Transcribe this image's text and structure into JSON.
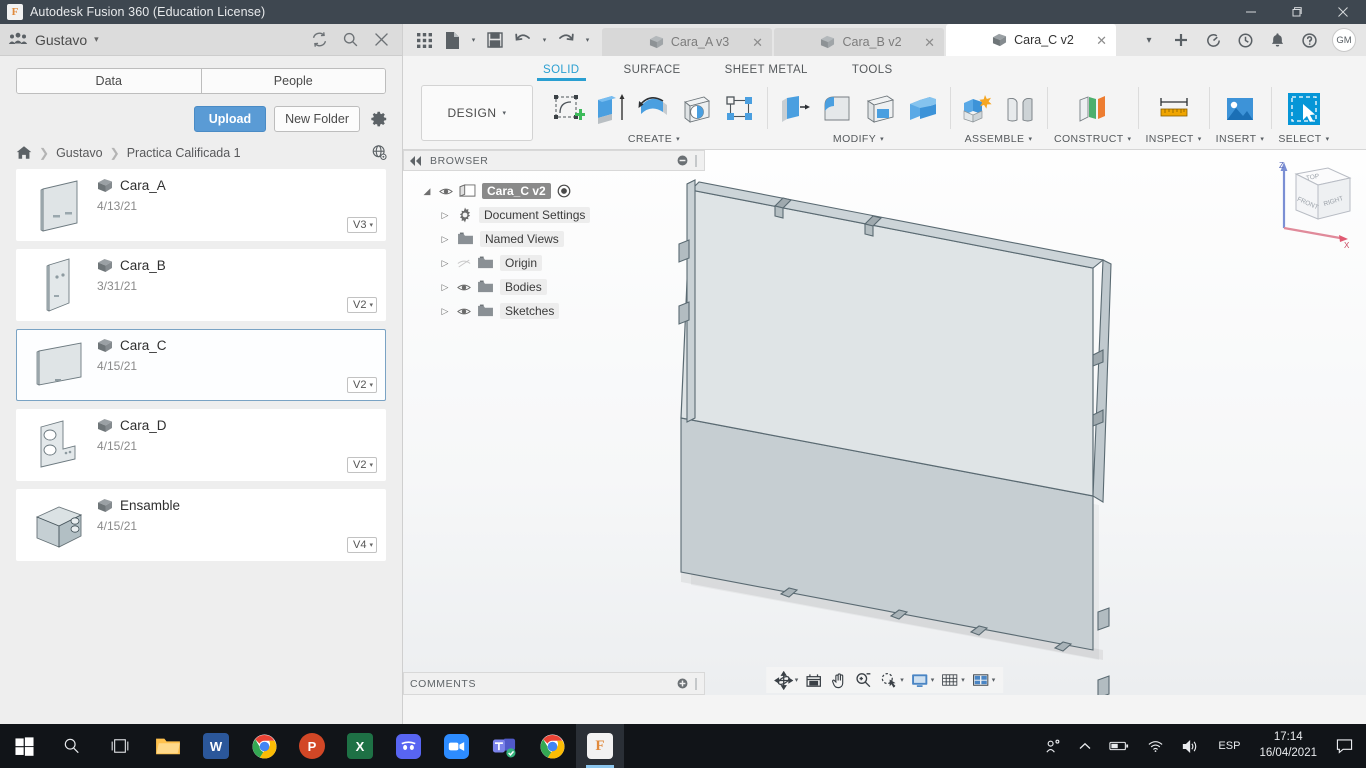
{
  "window": {
    "title": "Autodesk Fusion 360 (Education License)",
    "app_icon": "F",
    "minimize_label": "–",
    "maximize_label": "❐",
    "close_label": "✕"
  },
  "data_panel": {
    "user": "Gustavo",
    "user_caret": "▾",
    "refresh_icon": "refresh-icon",
    "search_icon": "search-icon",
    "close_icon": "close-icon",
    "tabs": [
      {
        "label": "Data",
        "active": true
      },
      {
        "label": "People",
        "active": false
      }
    ],
    "upload_label": "Upload",
    "new_folder_label": "New Folder",
    "settings_icon": "gear-icon",
    "breadcrumb": {
      "home_icon": "home-icon",
      "sep": "❯",
      "items": [
        "Gustavo",
        "Practica Calificada 1"
      ],
      "globe_icon": "globe-icon"
    },
    "files": [
      {
        "name": "Cara_A",
        "date": "4/13/21",
        "version": "V3",
        "selected": false
      },
      {
        "name": "Cara_B",
        "date": "3/31/21",
        "version": "V2",
        "selected": false
      },
      {
        "name": "Cara_C",
        "date": "4/15/21",
        "version": "V2",
        "selected": true
      },
      {
        "name": "Cara_D",
        "date": "4/15/21",
        "version": "V2",
        "selected": false
      },
      {
        "name": "Ensamble",
        "date": "4/15/21",
        "version": "V4",
        "selected": false
      }
    ],
    "version_caret": "▾"
  },
  "quick_access": {
    "grid_icon": "app-grid-icon",
    "new_icon": "new-document-icon",
    "save_icon": "save-icon",
    "undo_icon": "undo-icon",
    "redo_icon": "redo-icon",
    "dropdown_caret": "▾"
  },
  "document_tabs": [
    {
      "label": "Cara_A v3",
      "active": false,
      "close": "✕"
    },
    {
      "label": "Cara_B v2",
      "active": false,
      "close": "✕"
    },
    {
      "label": "Cara_C v2",
      "active": true,
      "close": "✕"
    }
  ],
  "tabbar_right": {
    "overflow_caret": "▾",
    "add_tab": "+",
    "job_status_icon": "job-status-icon",
    "history_icon": "clock-icon",
    "notifications_icon": "bell-icon",
    "help_icon": "help-icon",
    "avatar_initials": "GM"
  },
  "ribbon": {
    "workspace": "DESIGN",
    "workspace_caret": "▾",
    "tabs": [
      {
        "label": "SOLID",
        "active": true
      },
      {
        "label": "SURFACE",
        "active": false
      },
      {
        "label": "SHEET METAL",
        "active": false
      },
      {
        "label": "TOOLS",
        "active": false
      }
    ],
    "groups": [
      {
        "label": "CREATE",
        "caret": "▾",
        "icons": [
          "create-sketch-icon",
          "extrude-icon",
          "revolve-icon",
          "hole-icon",
          "pattern-icon"
        ]
      },
      {
        "label": "MODIFY",
        "caret": "▾",
        "icons": [
          "press-pull-icon",
          "fillet-icon",
          "shell-icon",
          "combine-icon"
        ]
      },
      {
        "label": "ASSEMBLE",
        "caret": "▾",
        "icons": [
          "new-component-icon",
          "joint-icon"
        ]
      },
      {
        "label": "CONSTRUCT",
        "caret": "▾",
        "icons": [
          "offset-plane-icon"
        ]
      },
      {
        "label": "INSPECT",
        "caret": "▾",
        "icons": [
          "measure-icon"
        ]
      },
      {
        "label": "INSERT",
        "caret": "▾",
        "icons": [
          "insert-image-icon"
        ]
      },
      {
        "label": "SELECT",
        "caret": "▾",
        "icons": [
          "select-window-icon"
        ]
      }
    ]
  },
  "browser": {
    "title": "BROWSER",
    "collapse_icon": "collapse-left-icon",
    "minus_icon": "minus-circle-icon",
    "grip_icon": "grip-icon",
    "root": {
      "label": "Cara_C v2",
      "eye_icon": "eye-icon",
      "doc_icon": "document-icon",
      "activate_icon": "activate-radio-icon",
      "expand": "◢"
    },
    "nodes": [
      {
        "label": "Document Settings",
        "icon": "gear-icon",
        "eye": "none",
        "arrow": "▷"
      },
      {
        "label": "Named Views",
        "icon": "folder-icon",
        "eye": "none",
        "arrow": "▷"
      },
      {
        "label": "Origin",
        "icon": "folder-icon",
        "eye": "hidden",
        "arrow": "▷"
      },
      {
        "label": "Bodies",
        "icon": "folder-icon",
        "eye": "visible",
        "arrow": "▷"
      },
      {
        "label": "Sketches",
        "icon": "folder-icon",
        "eye": "visible",
        "arrow": "▷"
      }
    ]
  },
  "viewcube": {
    "faces": [
      "TOP",
      "FRONT",
      "RIGHT"
    ],
    "axes": [
      "Z",
      "X"
    ]
  },
  "model": {
    "name": "Cara_C",
    "description": "flat rectangular plate with notched tabs along all four edges",
    "face_color": "#dfe4e6",
    "edge_color": "#5a6a72",
    "side_color": "#b8c3c8"
  },
  "comments": {
    "title": "COMMENTS",
    "add_icon": "add-comment-icon",
    "grip_icon": "grip-icon"
  },
  "navbar": {
    "items": [
      {
        "icon": "orbit-icon",
        "caret": "▾"
      },
      {
        "icon": "look-at-icon",
        "caret": ""
      },
      {
        "icon": "pan-icon",
        "caret": ""
      },
      {
        "icon": "zoom-icon",
        "caret": ""
      },
      {
        "icon": "fit-icon",
        "caret": "▾"
      },
      {
        "icon": "display-settings-icon",
        "caret": "▾"
      },
      {
        "icon": "grid-snap-icon",
        "caret": "▾"
      },
      {
        "icon": "viewports-icon",
        "caret": "▾"
      }
    ]
  },
  "timeline": {
    "buttons": [
      "go-to-start-icon",
      "step-back-icon",
      "play-icon",
      "step-forward-icon",
      "go-to-end-icon"
    ],
    "marker_icon": "timeline-feature-icon",
    "settings_icon": "gear-icon"
  },
  "taskbar": {
    "start_icon": "windows-start-icon",
    "search_icon": "search-icon",
    "taskview_icon": "task-view-icon",
    "apps": [
      {
        "name": "file-explorer-icon",
        "label": "",
        "color": "#ffc14d",
        "active": false
      },
      {
        "name": "word-icon",
        "label": "W",
        "color": "#2b579a",
        "active": false
      },
      {
        "name": "chrome-icon",
        "label": "",
        "color": "#ffffff",
        "active": false
      },
      {
        "name": "powerpoint-icon",
        "label": "P",
        "color": "#d24726",
        "active": false
      },
      {
        "name": "excel-icon",
        "label": "X",
        "color": "#1e7145",
        "active": false
      },
      {
        "name": "discord-icon",
        "label": "",
        "color": "#5865f2",
        "active": false
      },
      {
        "name": "zoom-app-icon",
        "label": "",
        "color": "#2d8cff",
        "active": false
      },
      {
        "name": "teams-icon",
        "label": "T",
        "color": "#5059c9",
        "active": false
      },
      {
        "name": "chrome-icon-2",
        "label": "",
        "color": "#ffffff",
        "active": false
      },
      {
        "name": "fusion360-icon",
        "label": "F",
        "color": "#f5f5f5",
        "active": true
      }
    ],
    "tray": {
      "people_icon": "people-share-icon",
      "chevron_icon": "show-hidden-icons-icon",
      "battery_icon": "battery-icon",
      "wifi_icon": "wifi-icon",
      "volume_icon": "volume-icon",
      "language": "ESP",
      "time": "17:14",
      "date": "16/04/2021",
      "action_center_icon": "action-center-icon"
    }
  }
}
